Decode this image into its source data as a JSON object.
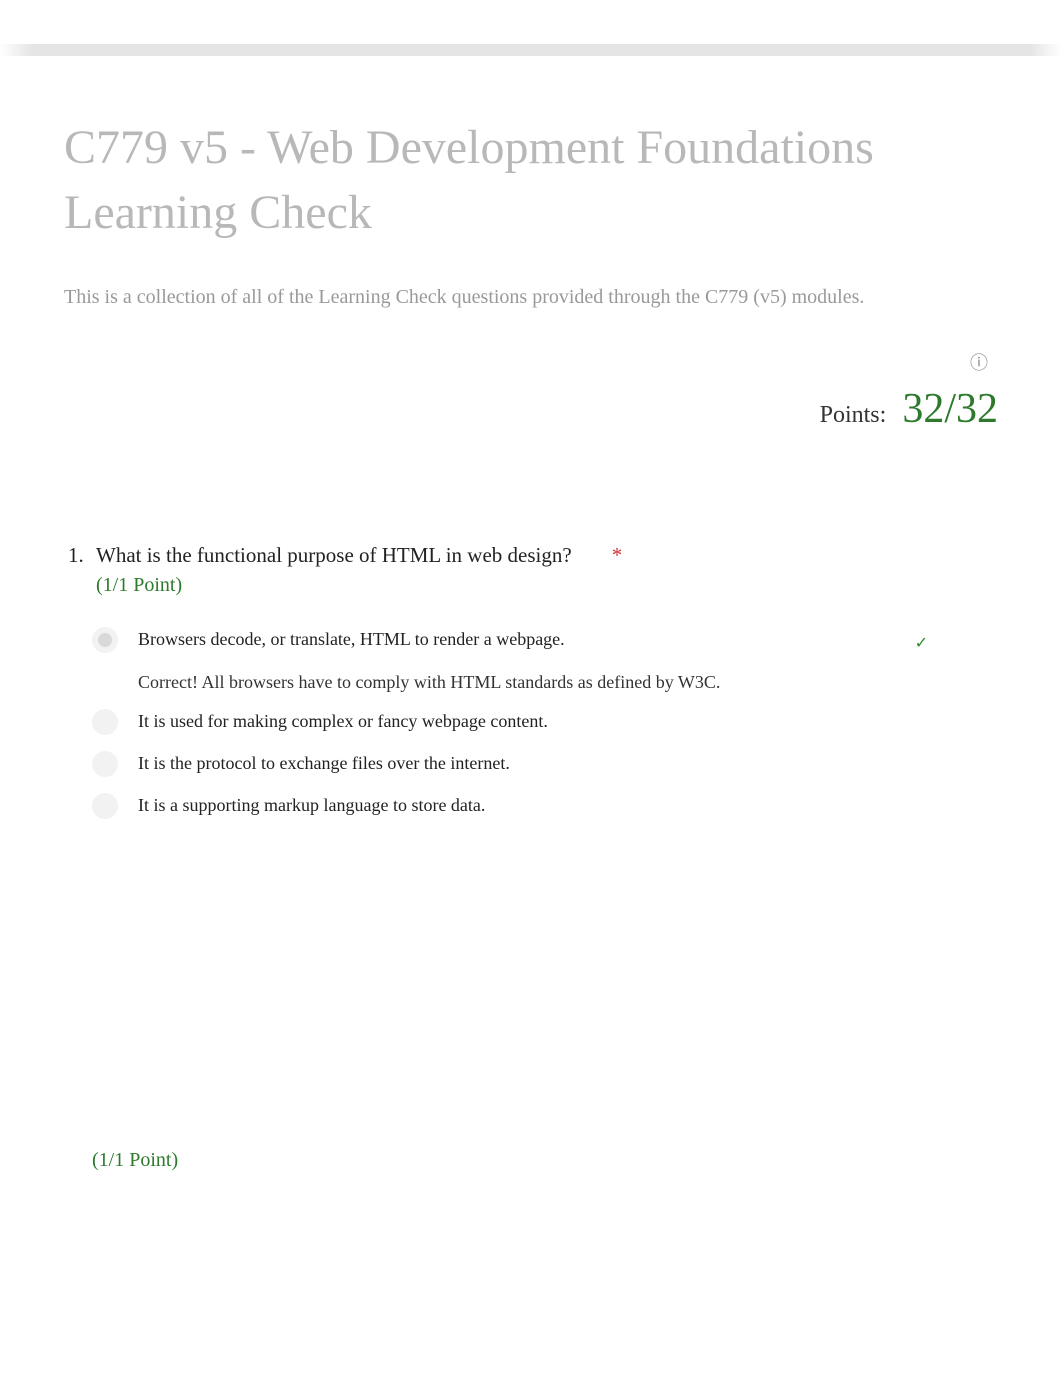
{
  "header": {
    "title": "C779 v5 - Web Development Foundations Learning Check",
    "description": "This is a collection of all of the Learning Check questions provided through the C779 (v5) modules."
  },
  "score": {
    "label": "Points:",
    "value": "32/32"
  },
  "question1": {
    "number": "1.",
    "text": "What is the functional purpose of HTML in web design?",
    "required": "*",
    "points": "(1/1 Point)",
    "options": [
      {
        "text": "Browsers decode, or translate, HTML to render a webpage.",
        "feedback": "Correct! All browsers have to comply with HTML standards as defined by W3C.",
        "selected": true,
        "correct": true
      },
      {
        "text": "It is used for making complex or fancy webpage content.",
        "selected": false
      },
      {
        "text": "It is the protocol to exchange files over the internet.",
        "selected": false
      },
      {
        "text": "It is a supporting markup language to store data.",
        "selected": false
      }
    ]
  },
  "question2": {
    "points": "(1/1 Point)"
  },
  "icons": {
    "info": "ⓘ",
    "check": "✓"
  }
}
